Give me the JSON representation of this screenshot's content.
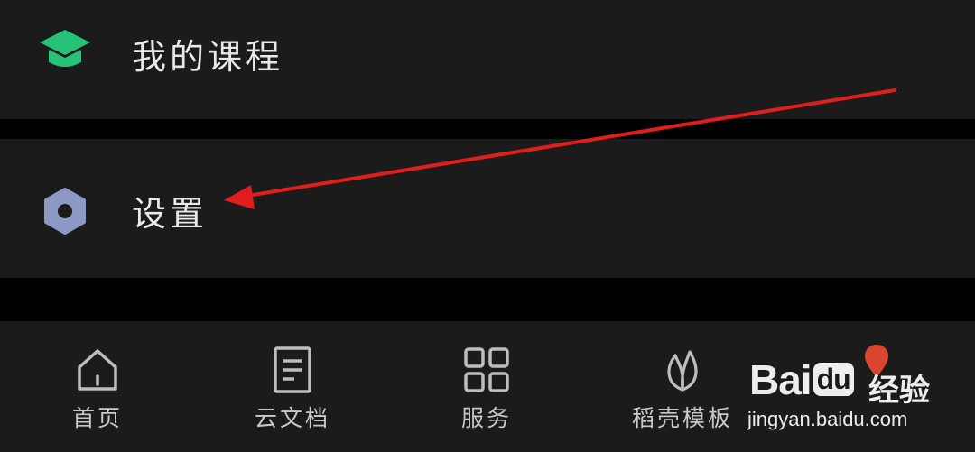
{
  "menu": {
    "courses_label": "我的课程",
    "settings_label": "设置",
    "courses_icon": "graduation-cap-icon",
    "settings_icon": "settings-hexagon-icon",
    "courses_icon_color": "#27c27a",
    "settings_icon_color": "#8d98c4"
  },
  "tabbar": {
    "tabs": [
      {
        "label": "首页",
        "icon": "home-icon"
      },
      {
        "label": "云文档",
        "icon": "document-icon"
      },
      {
        "label": "服务",
        "icon": "grid-icon"
      },
      {
        "label": "稻壳模板",
        "icon": "leaf-icon"
      }
    ]
  },
  "annotation": {
    "arrow_color": "#e21d1d"
  },
  "watermark": {
    "brand": "Bai",
    "brand_du": "du",
    "jingyan": "经验",
    "url": "jingyan.baidu.com"
  }
}
